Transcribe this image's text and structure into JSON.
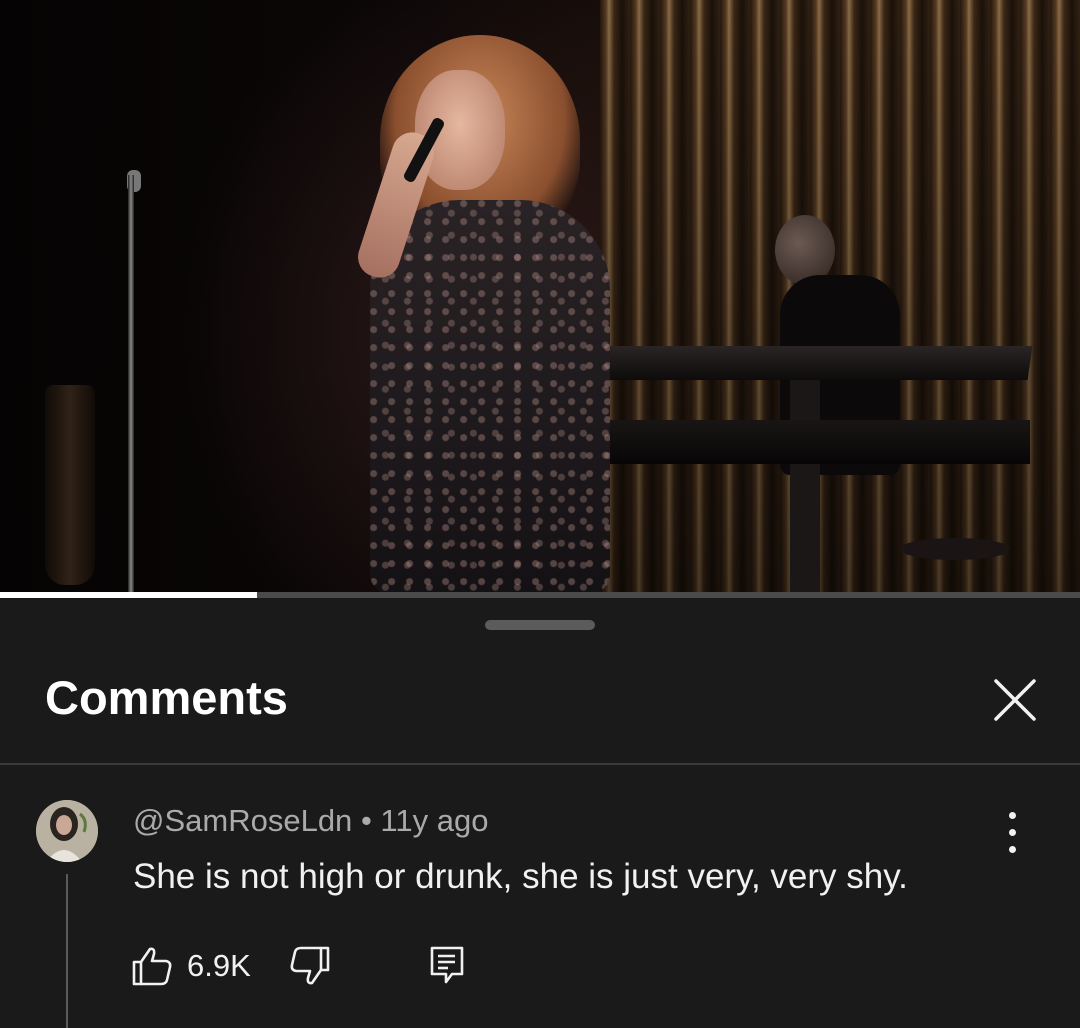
{
  "video": {
    "progress_fraction": 0.238
  },
  "comments_panel": {
    "title": "Comments",
    "close_icon": "close-icon"
  },
  "comment": {
    "author": "@SamRoseLdn",
    "separator": "•",
    "time_ago": "11y ago",
    "text": "She is not high or drunk, she is just very, very shy.",
    "like_count": "6.9K",
    "icons": {
      "like": "thumbs-up-icon",
      "dislike": "thumbs-down-icon",
      "reply": "reply-icon",
      "more": "more-vert-icon"
    }
  },
  "colors": {
    "background": "#0f0f0f",
    "sheet": "#1a1a1a",
    "text_primary": "#f1f1f1",
    "text_secondary": "#aaaaaa",
    "progress_fill": "#ffffff",
    "progress_track": "#4a4a4a"
  }
}
